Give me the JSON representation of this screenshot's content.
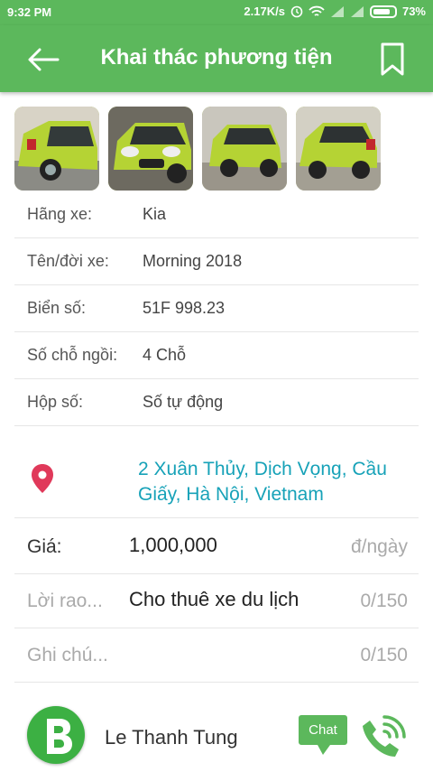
{
  "status_bar": {
    "time": "9:32 PM",
    "speed": "2.17K/s",
    "battery": "73%"
  },
  "app_bar": {
    "title": "Khai thác phương tiện"
  },
  "vehicle_info": [
    {
      "label": "Hãng xe:",
      "value": "Kia"
    },
    {
      "label": "Tên/đời xe:",
      "value": "Morning 2018"
    },
    {
      "label": "Biển số:",
      "value": "51F 998.23"
    },
    {
      "label": "Số chỗ ngồi:",
      "value": "4 Chỗ"
    },
    {
      "label": "Hộp số:",
      "value": "Số tự động"
    }
  ],
  "address": "2 Xuân Thủy, Dịch Vọng, Cầu Giấy, Hà Nội, Vietnam",
  "price": {
    "label": "Giá:",
    "value": "1,000,000",
    "unit": "đ/ngày"
  },
  "ad_text": {
    "placeholder": "Lời rao...",
    "value": "Cho thuê xe du lịch",
    "counter": "0/150"
  },
  "note": {
    "placeholder": "Ghi chú...",
    "counter": "0/150"
  },
  "owner": {
    "name": "Le Thanh Tung",
    "chat_label": "Chat"
  },
  "colors": {
    "primary": "#5cb85c",
    "link": "#17a2b8",
    "pin": "#e0395a"
  }
}
